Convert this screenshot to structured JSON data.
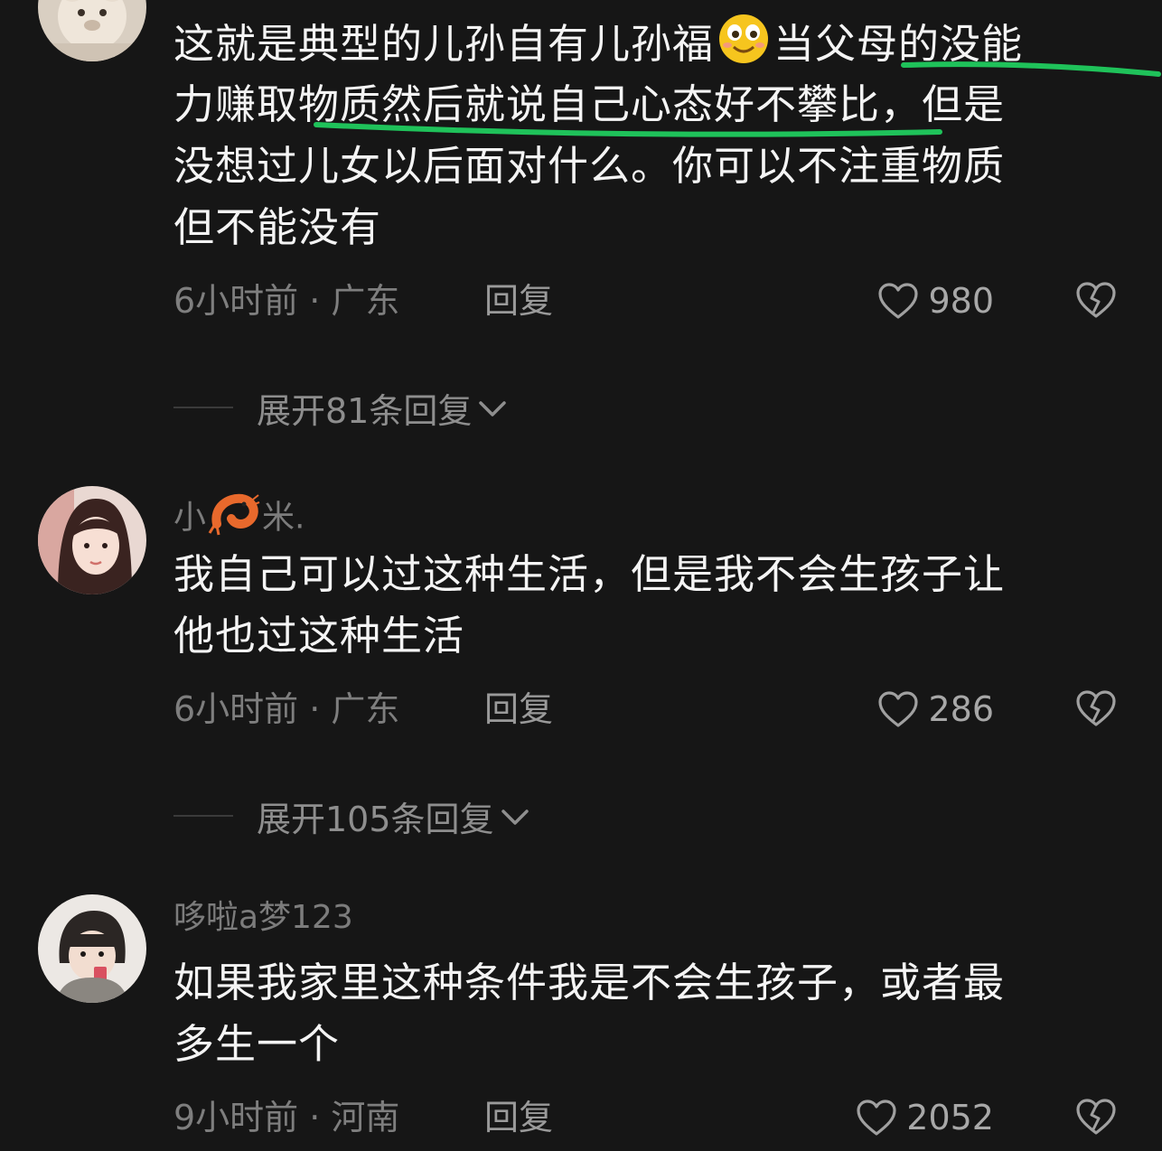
{
  "comments": [
    {
      "username": "",
      "lines": [
        "这就是典型的儿孙自有儿孙福",
        "当父母的没能",
        "力赚取物质然后就说自己心态好不攀比，但是",
        "没想过儿女以后面对什么。你可以不注重物质",
        "但不能没有"
      ],
      "time_location": "6小时前 · 广东",
      "reply_label": "回复",
      "like_count": "980",
      "expand_label": "展开81条回复"
    },
    {
      "username_prefix": "小",
      "username_suffix": "米.",
      "lines": [
        "我自己可以过这种生活，但是我不会生孩子让",
        "他也过这种生活"
      ],
      "time_location": "6小时前 · 广东",
      "reply_label": "回复",
      "like_count": "286",
      "expand_label": "展开105条回复"
    },
    {
      "username": "哆啦a梦123",
      "lines": [
        "如果我家里这种条件我是不会生孩子，或者最",
        "多生一个"
      ],
      "time_location": "9小时前 · 河南",
      "reply_label": "回复",
      "like_count": "2052"
    }
  ],
  "colors": {
    "background": "#161616",
    "text": "#f4f4f4",
    "muted": "#7e7e7e",
    "highlight_underline": "#1fc25a"
  },
  "icons": [
    "heart-outline-icon",
    "broken-heart-icon",
    "chevron-down-icon",
    "smiling-emoji-icon",
    "shrimp-emoji-icon"
  ]
}
